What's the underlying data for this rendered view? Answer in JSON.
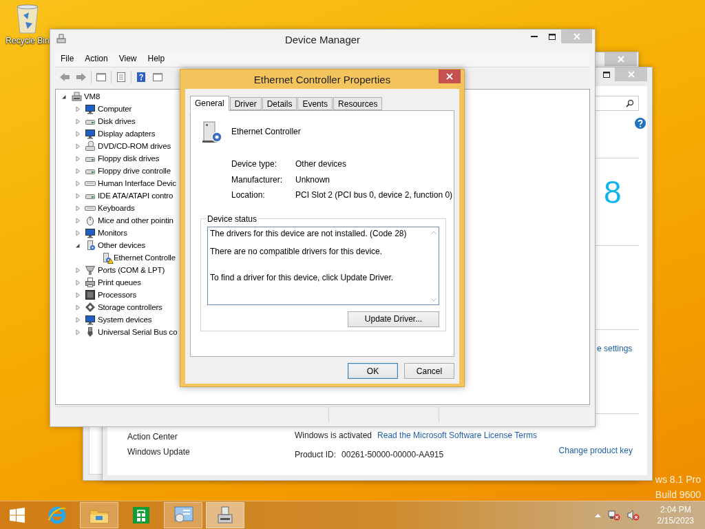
{
  "desktop": {
    "icons": [
      {
        "label": "Recycle Bin"
      }
    ],
    "edition_lines": [
      "ws 8.1 Pro",
      "Build 9600"
    ]
  },
  "system_window": {
    "logo_fragment": "8",
    "settings_link": "e settings",
    "see_also": [
      "Action Center",
      "Windows Update"
    ],
    "activation_status": "Windows is activated",
    "license_link": "Read the Microsoft Software License Terms",
    "product_id_label": "Product ID:",
    "product_id": "00261-50000-00000-AA915",
    "change_key_link": "Change product key"
  },
  "device_manager": {
    "title": "Device Manager",
    "menu": [
      "File",
      "Action",
      "View",
      "Help"
    ],
    "tree": {
      "label": "VM8",
      "kind": "machine",
      "expanded": true,
      "children": [
        {
          "label": "Computer",
          "kind": "monitor",
          "expanded": false
        },
        {
          "label": "Disk drives",
          "kind": "drive",
          "expanded": false
        },
        {
          "label": "Display adapters",
          "kind": "monitor",
          "expanded": false
        },
        {
          "label": "DVD/CD-ROM drives",
          "kind": "optical",
          "expanded": false
        },
        {
          "label": "Floppy disk drives",
          "kind": "drive",
          "expanded": false
        },
        {
          "label": "Floppy drive controlle",
          "kind": "drive",
          "expanded": false
        },
        {
          "label": "Human Interface Devic",
          "kind": "keyboard",
          "expanded": false
        },
        {
          "label": "IDE ATA/ATAPI contro",
          "kind": "drive",
          "expanded": false
        },
        {
          "label": "Keyboards",
          "kind": "keyboard",
          "expanded": false
        },
        {
          "label": "Mice and other pointin",
          "kind": "mouse",
          "expanded": false
        },
        {
          "label": "Monitors",
          "kind": "monitor",
          "expanded": false
        },
        {
          "label": "Other devices",
          "kind": "unknown",
          "expanded": true,
          "children": [
            {
              "label": "Ethernet Controlle",
              "kind": "unknown",
              "warning": true
            }
          ]
        },
        {
          "label": "Ports (COM & LPT)",
          "kind": "port",
          "expanded": false
        },
        {
          "label": "Print queues",
          "kind": "printer",
          "expanded": false
        },
        {
          "label": "Processors",
          "kind": "chip",
          "expanded": false
        },
        {
          "label": "Storage controllers",
          "kind": "storage",
          "expanded": false
        },
        {
          "label": "System devices",
          "kind": "monitor",
          "expanded": false
        },
        {
          "label": "Universal Serial Bus co",
          "kind": "usb",
          "expanded": false
        }
      ]
    }
  },
  "properties_dialog": {
    "title": "Ethernet Controller Properties",
    "tabs": [
      {
        "label": "General",
        "selected": true
      },
      {
        "label": "Driver",
        "selected": false
      },
      {
        "label": "Details",
        "selected": false
      },
      {
        "label": "Events",
        "selected": false
      },
      {
        "label": "Resources",
        "selected": false
      }
    ],
    "device_name": "Ethernet Controller",
    "fields": [
      {
        "label": "Device type:",
        "value": "Other devices"
      },
      {
        "label": "Manufacturer:",
        "value": "Unknown"
      },
      {
        "label": "Location:",
        "value": "PCI Slot 2 (PCI bus 0, device 2, function 0)"
      }
    ],
    "status_group": "Device status",
    "status_lines": [
      "The drivers for this device are not installed. (Code 28)",
      "There are no compatible drivers for this device.",
      "To find a driver for this device, click Update Driver."
    ],
    "update_button": "Update Driver...",
    "buttons": [
      {
        "label": "OK",
        "default": true
      },
      {
        "label": "Cancel",
        "default": false
      }
    ]
  },
  "taskbar": {
    "apps": [
      {
        "kind": "ie",
        "running": false,
        "selected": false
      },
      {
        "kind": "explorer",
        "running": true,
        "selected": false
      },
      {
        "kind": "store",
        "running": false,
        "selected": false
      },
      {
        "kind": "control_panel",
        "running": true,
        "selected": false
      },
      {
        "kind": "device_manager",
        "running": true,
        "selected": true
      }
    ],
    "clock": {
      "time": "2:04 PM",
      "date": "2/15/2023"
    }
  }
}
